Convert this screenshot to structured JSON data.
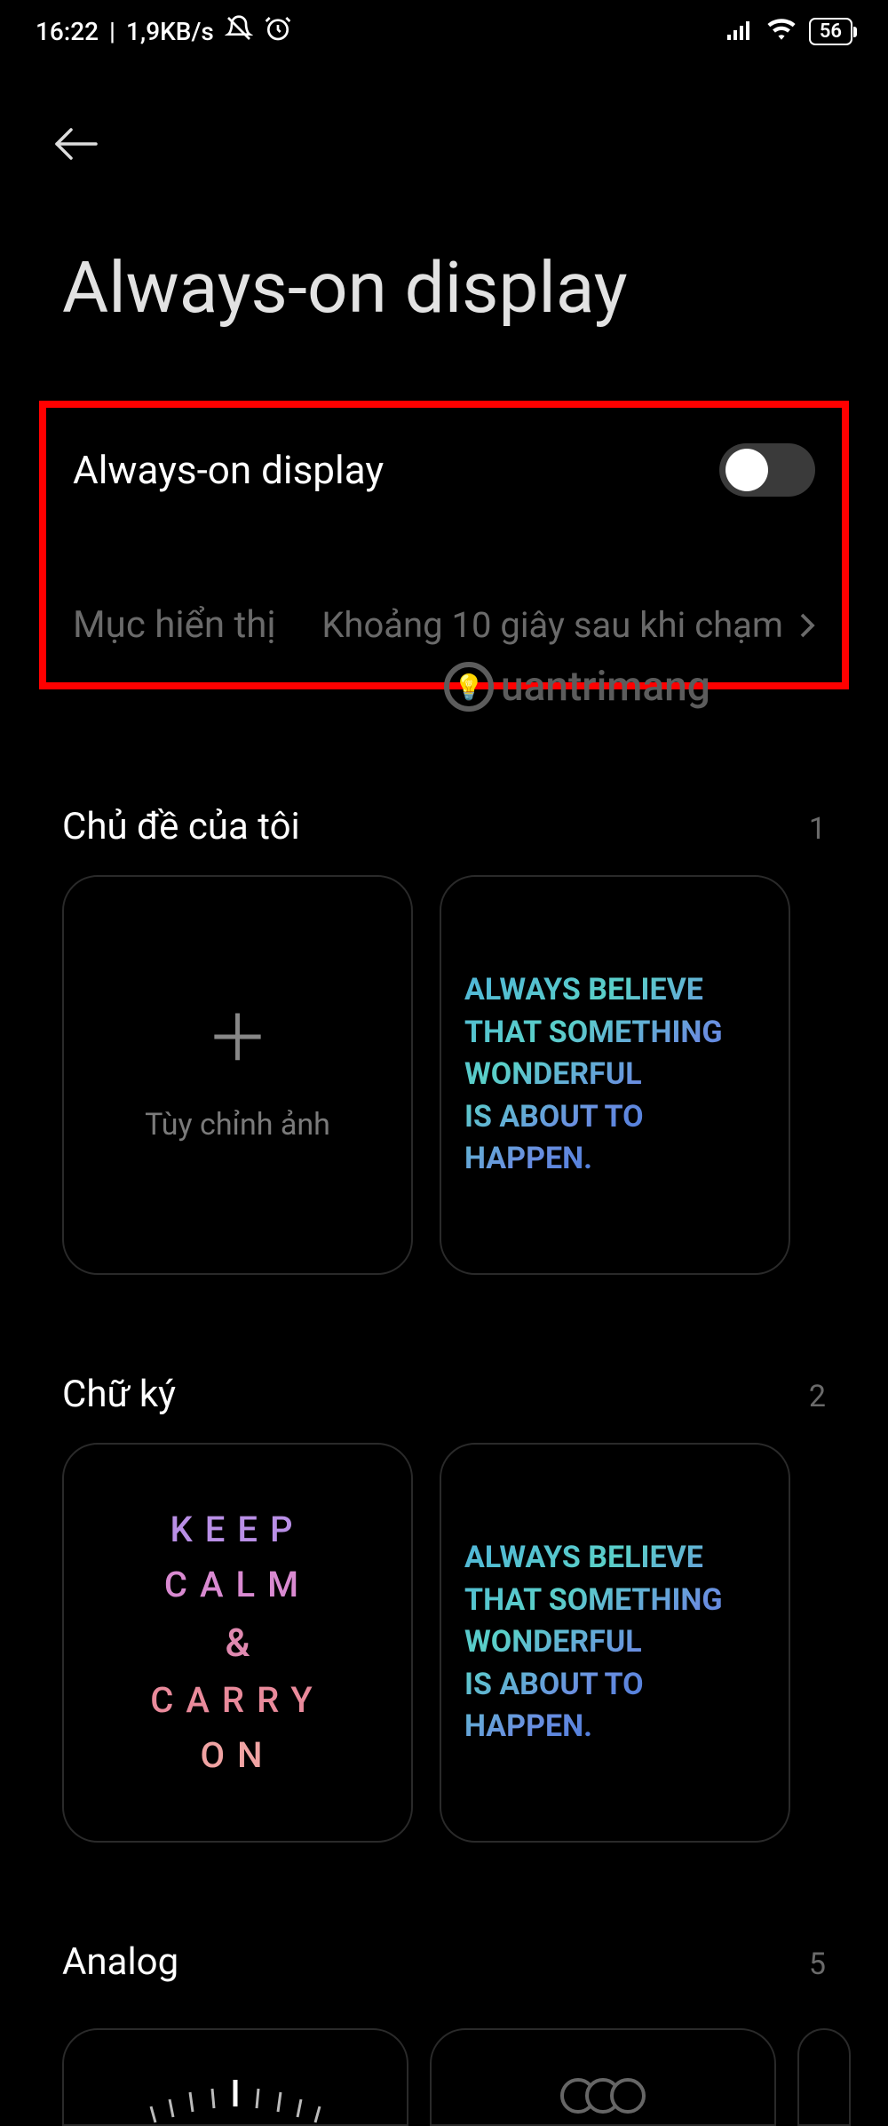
{
  "status": {
    "time": "16:22",
    "speed": "1,9KB/s",
    "battery": "56"
  },
  "page_title": "Always-on display",
  "toggle": {
    "label": "Always-on display",
    "enabled": false
  },
  "display_option": {
    "label": "Mục hiển thị",
    "value": "Khoảng 10 giây sau khi chạm"
  },
  "watermark": "uantrimang",
  "sections": {
    "mythemes": {
      "title": "Chủ đề của tôi",
      "count": "1",
      "custom_label": "Tùy chỉnh ảnh",
      "believe": "ALWAYS BELIEVE THAT SOMETHING WONDERFUL\nIS ABOUT TO HAPPEN."
    },
    "signature": {
      "title": "Chữ ký",
      "count": "2",
      "keepcalm": {
        "l1": "KEEP",
        "l2": "CALM",
        "l3": "&",
        "l4": "CARRY",
        "l5": "ON"
      },
      "believe": "ALWAYS BELIEVE THAT SOMETHING WONDERFUL\nIS ABOUT TO HAPPEN."
    },
    "analog": {
      "title": "Analog",
      "count": "5"
    }
  }
}
